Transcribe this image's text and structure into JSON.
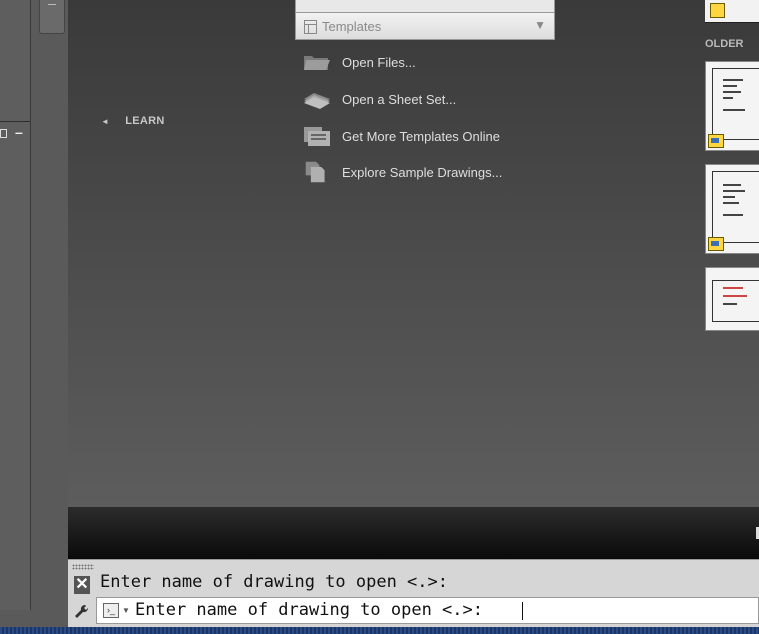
{
  "learn": {
    "label": "LEARN"
  },
  "templates": {
    "label": "Templates"
  },
  "actions": [
    {
      "label": "Open Files...",
      "icon": "folder-open-icon"
    },
    {
      "label": "Open a Sheet Set...",
      "icon": "sheet-set-icon"
    },
    {
      "label": "Get More Templates Online",
      "icon": "templates-online-icon"
    },
    {
      "label": "Explore Sample Drawings...",
      "icon": "sample-drawings-icon"
    }
  ],
  "recent": {
    "section_label": "OLDER"
  },
  "left_panel": {
    "minimize_label": "–"
  },
  "command": {
    "history_line": "Enter name of drawing to open <.>:",
    "prompt_text": "Enter name of drawing to open <.>:",
    "close_label": "✕",
    "customize_icon": "wrench-icon"
  },
  "colors": {
    "background": "#4a4a4a",
    "command_bg": "#d6d6d6",
    "accent": "#ffd640"
  }
}
